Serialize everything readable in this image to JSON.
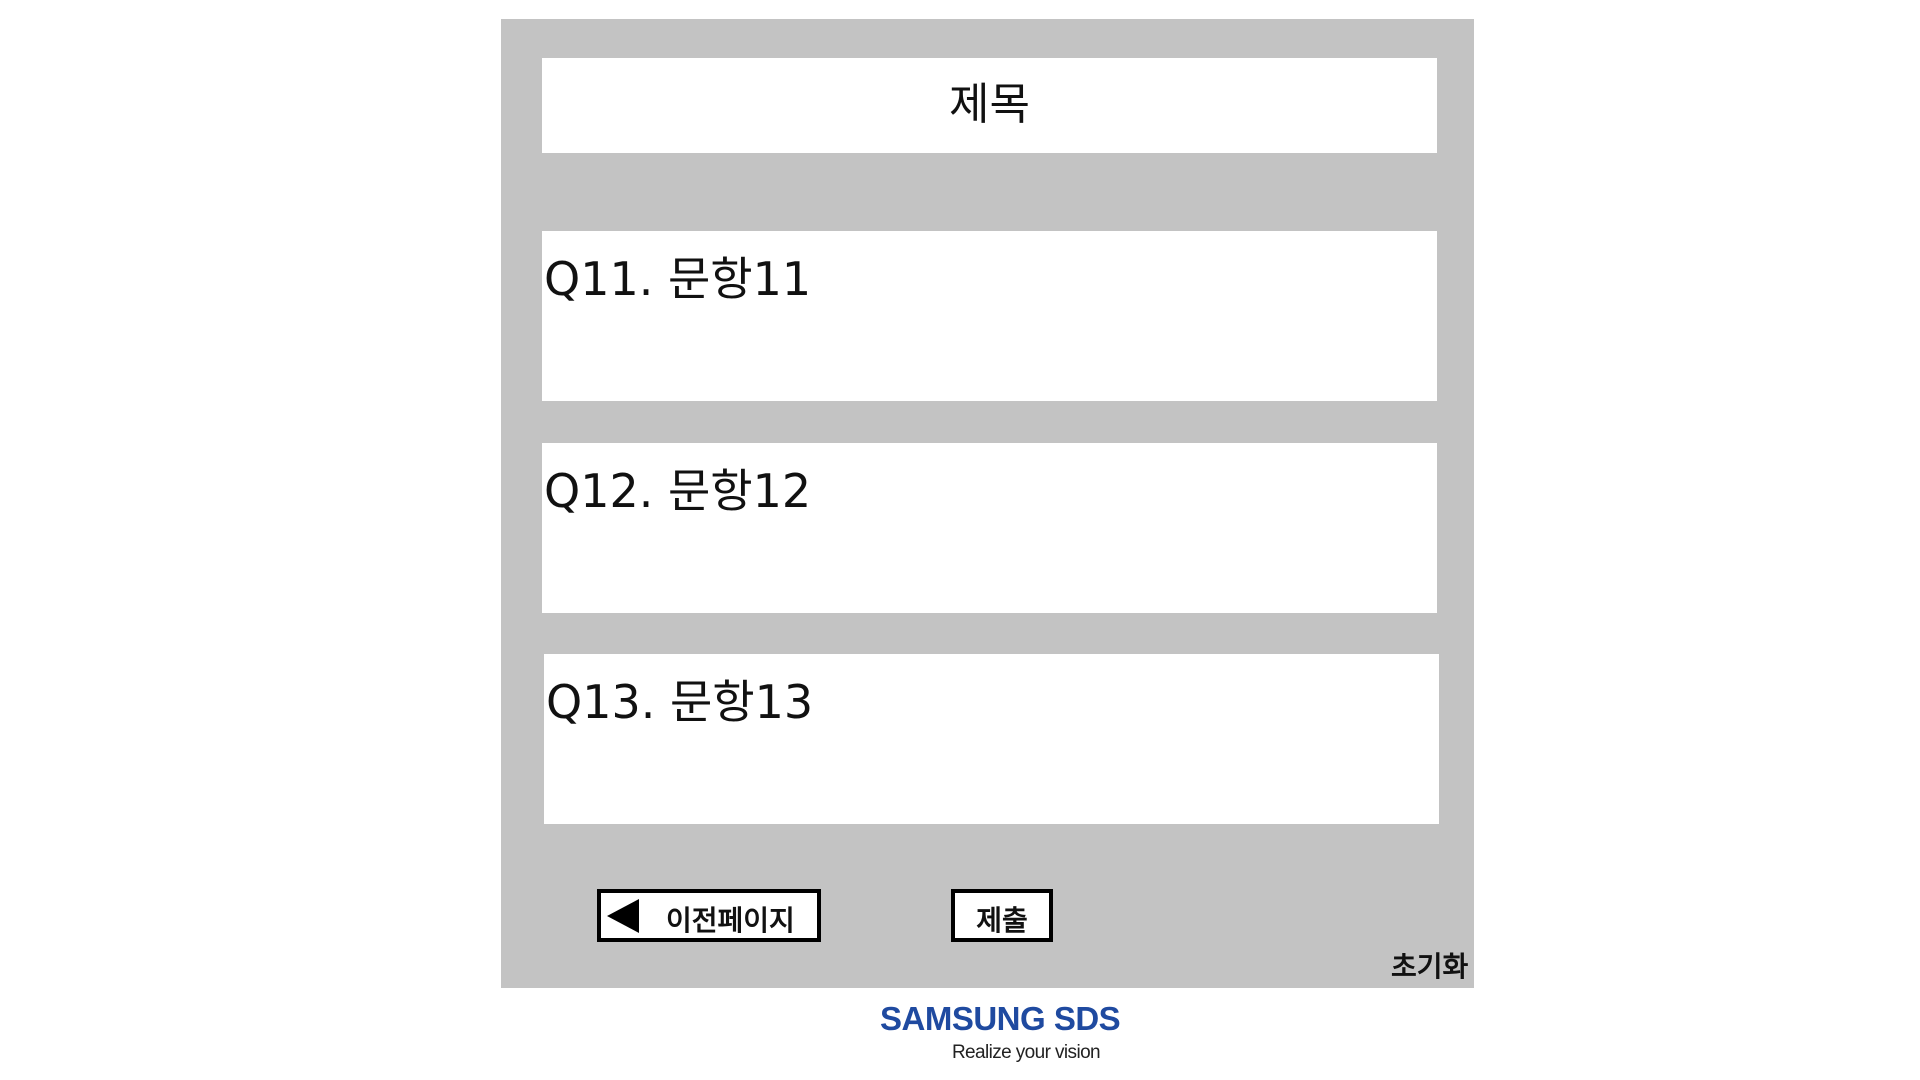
{
  "form": {
    "title": "제목",
    "questions": [
      {
        "label": "Q11. 문항11"
      },
      {
        "label": "Q12. 문항12"
      },
      {
        "label": "Q13. 문항13"
      }
    ],
    "buttons": {
      "prev_label": "이전페이지",
      "submit_label": "제출",
      "reset_label": "초기화"
    }
  },
  "footer": {
    "logo_name": "SAMSUNG SDS",
    "logo_tagline": "Realize your vision"
  },
  "colors": {
    "panel_background": "#c3c3c3",
    "box_background": "#ffffff",
    "button_border": "#000000",
    "logo_blue": "#1f4aa0"
  },
  "icons": {
    "prev_arrow": "triangle-left-icon"
  }
}
